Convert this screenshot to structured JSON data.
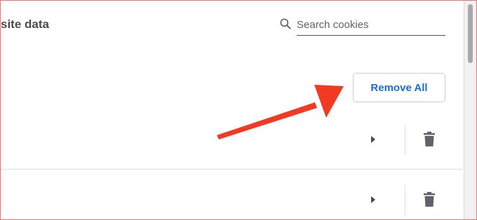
{
  "header": {
    "title": "site data"
  },
  "search": {
    "placeholder": "Search cookies",
    "value": "",
    "icon": "search-icon"
  },
  "actions": {
    "remove_all_label": "Remove All"
  },
  "rows": [
    {
      "expand_icon": "arrow-right-icon",
      "delete_icon": "trash-icon"
    },
    {
      "expand_icon": "arrow-right-icon",
      "delete_icon": "trash-icon"
    }
  ],
  "annotation": {
    "arrow_color": "#f23a22"
  },
  "colors": {
    "accent": "#1a6fd1",
    "frame_border": "#e8786f",
    "icon": "#5f6368"
  }
}
